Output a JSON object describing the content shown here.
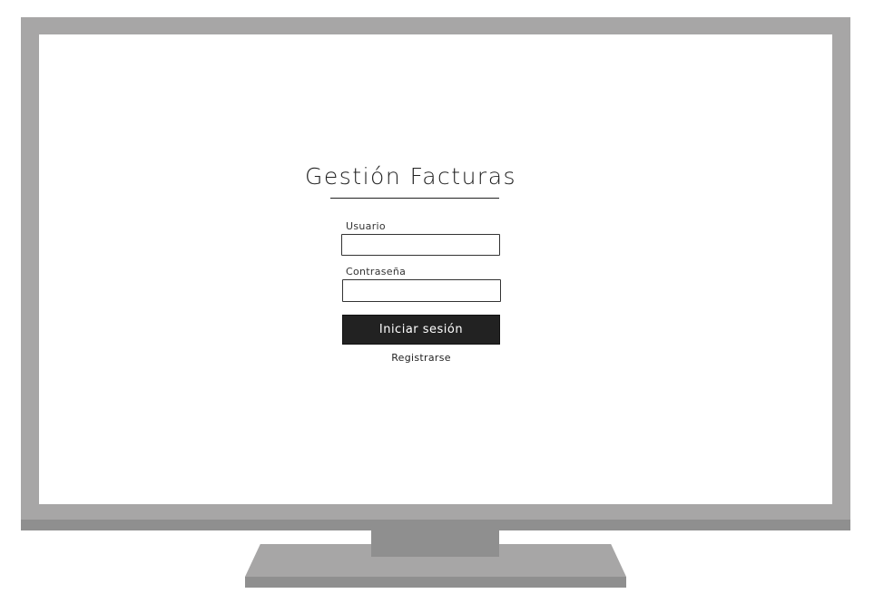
{
  "app": {
    "title": "Gestión Facturas"
  },
  "login_form": {
    "username_label": "Usuario",
    "username_value": "",
    "password_label": "Contraseña",
    "password_value": "",
    "submit_label": "Iniciar sesión",
    "register_label": "Registrarse"
  },
  "colors": {
    "monitor_frame": "#a7a6a6",
    "monitor_shadow": "#8f8f8f",
    "button_background": "#222222",
    "button_text": "#ffffff"
  }
}
